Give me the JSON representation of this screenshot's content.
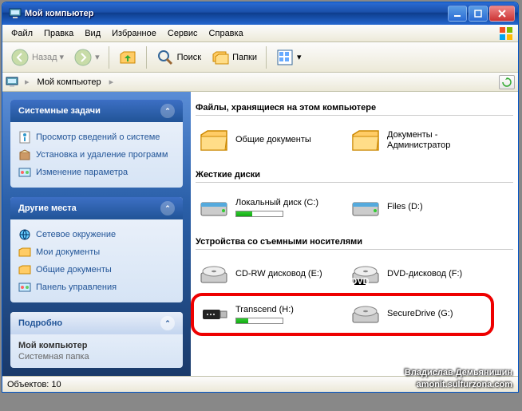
{
  "title": "Мой компьютер",
  "menus": [
    "Файл",
    "Правка",
    "Вид",
    "Избранное",
    "Сервис",
    "Справка"
  ],
  "toolbar": {
    "back": "Назад",
    "search": "Поиск",
    "folders": "Папки"
  },
  "address": {
    "current": "Мой компьютер"
  },
  "sidebar": {
    "panels": [
      {
        "title": "Системные задачи",
        "items": [
          "Просмотр сведений о системе",
          "Установка и удаление программ",
          "Изменение параметра"
        ]
      },
      {
        "title": "Другие места",
        "items": [
          "Сетевое окружение",
          "Мои документы",
          "Общие документы",
          "Панель управления"
        ]
      },
      {
        "title": "Подробно",
        "details_title": "Мой компьютер",
        "details_sub": "Системная папка"
      }
    ]
  },
  "main": {
    "sections": [
      {
        "header": "Файлы, хранящиеся на этом компьютере",
        "items": [
          {
            "label": "Общие документы",
            "type": "folder"
          },
          {
            "label": "Документы - Администратор",
            "type": "folder"
          }
        ]
      },
      {
        "header": "Жесткие диски",
        "items": [
          {
            "label": "Локальный диск (C:)",
            "type": "hdd",
            "fill": 35
          },
          {
            "label": "Files (D:)",
            "type": "hdd"
          }
        ]
      },
      {
        "header": "Устройства со съемными носителями",
        "items": [
          {
            "label": "CD-RW дисковод (E:)",
            "type": "cd"
          },
          {
            "label": "DVD-дисковод (F:)",
            "type": "dvd"
          },
          {
            "label": "Transcend (H:)",
            "type": "usb",
            "fill": 25
          },
          {
            "label": "SecureDrive (G:)",
            "type": "removable"
          }
        ],
        "highlight_rows": [
          2,
          3
        ]
      }
    ]
  },
  "statusbar": {
    "objects_label": "Объектов: 10"
  },
  "watermark": {
    "line1": "Владислав Демьянишин",
    "line2": "amonit.sulfurzona.com"
  }
}
